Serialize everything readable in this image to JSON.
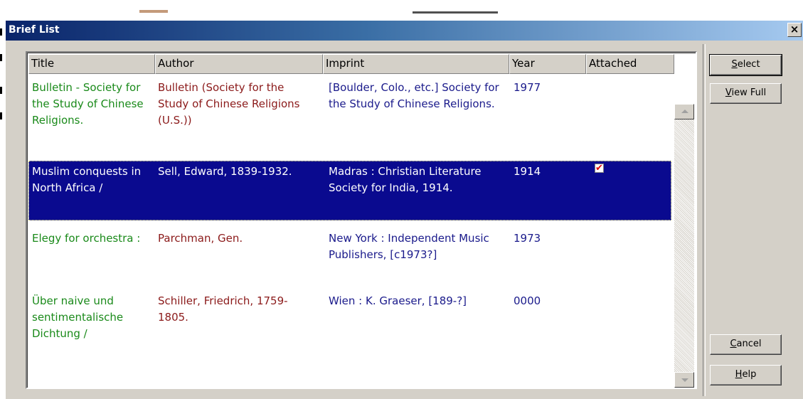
{
  "window": {
    "title": "Brief List",
    "close_label": "×"
  },
  "columns": [
    "Title",
    "Author",
    "Imprint",
    "Year",
    "Attached"
  ],
  "rows": [
    {
      "title": "Bulletin - Society for the Study of Chinese Religions.",
      "author": "Bulletin (Society for the Study of Chinese Religions (U.S.))",
      "imprint": "[Boulder, Colo., etc.] Society for the Study of Chinese Religions.",
      "year": "1977",
      "attached": false,
      "selected": false
    },
    {
      "title": "Muslim conquests in North Africa /",
      "author": "Sell, Edward, 1839-1932.",
      "imprint": "Madras : Christian Literature Society for India, 1914.",
      "year": "1914",
      "attached": true,
      "selected": true
    },
    {
      "title": "Elegy for orchestra :",
      "author": "Parchman, Gen.",
      "imprint": "New York : Independent Music Publishers, [c1973?]",
      "year": "1973",
      "attached": false,
      "selected": false
    },
    {
      "title": "Über naive und sentimentalische Dichtung /",
      "author": "Schiller, Friedrich, 1759-1805.",
      "imprint": "Wien : K. Graeser, [189-?]",
      "year": "0000",
      "attached": false,
      "selected": false
    }
  ],
  "buttons": {
    "select": {
      "underline": "S",
      "rest": "elect"
    },
    "view_full": {
      "underline": "V",
      "rest": "iew Full"
    },
    "cancel": {
      "underline": "C",
      "rest": "ancel"
    },
    "help": {
      "underline": "H",
      "rest": "elp"
    }
  },
  "colors": {
    "title_text": "#1a8a1a",
    "author_text": "#8b1a1a",
    "imprint_text": "#1a1a8b",
    "selection_bg": "#0a0a8f",
    "titlebar_start": "#0a246a",
    "titlebar_end": "#a6caf0",
    "checkmark": "#e00000"
  },
  "icons": {
    "attached_check": "checkmark-icon",
    "scroll_up": "scroll-up-arrow-icon",
    "scroll_down": "scroll-down-arrow-icon",
    "close": "close-icon"
  }
}
